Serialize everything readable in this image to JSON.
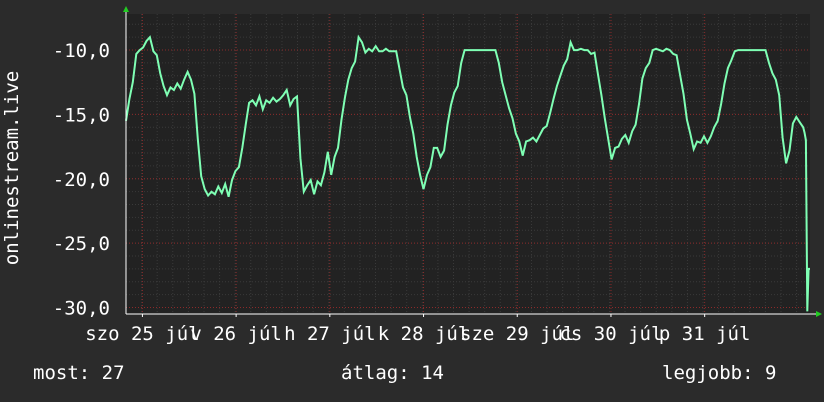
{
  "chart_data": {
    "type": "line",
    "ylabel": "onlinestream.live",
    "ylim": [
      -30.5,
      -7.2
    ],
    "yticks": [
      -30,
      -25,
      -20,
      -15,
      -10
    ],
    "ytick_labels": [
      "-30,0",
      "-25,0",
      "-20,0",
      "-15,0",
      "-10,0"
    ],
    "xlim": [
      0,
      100
    ],
    "xticks": [
      {
        "pos": 2.4,
        "label": "szo 25 júl"
      },
      {
        "pos": 16.1,
        "label": "v 26 júl"
      },
      {
        "pos": 29.8,
        "label": "h 27 júl"
      },
      {
        "pos": 43.5,
        "label": "k 28 júl"
      },
      {
        "pos": 57.2,
        "label": "sze 29 júl"
      },
      {
        "pos": 70.9,
        "label": "cs 30 júl"
      },
      {
        "pos": 84.6,
        "label": "p 31 júl"
      }
    ],
    "series": [
      {
        "color": "#7fffb4",
        "x": [
          0,
          0.5,
          1,
          1.5,
          2,
          2.5,
          3,
          3.5,
          4,
          4.5,
          5,
          5.5,
          6,
          6.5,
          7,
          7.5,
          8,
          8.5,
          9,
          9.5,
          10,
          10.5,
          11,
          11.5,
          12,
          12.5,
          13,
          13.5,
          14,
          14.5,
          15,
          15.5,
          16,
          16.5,
          17,
          17.5,
          18,
          18.5,
          19,
          19.5,
          20,
          20.5,
          21,
          21.5,
          22,
          22.5,
          23,
          23.5,
          24,
          24.5,
          25,
          25.5,
          26,
          26.5,
          27,
          27.5,
          28,
          28.5,
          29,
          29.5,
          30,
          30.5,
          31,
          31.5,
          32,
          32.5,
          33,
          33.5,
          34,
          34.5,
          35,
          35.5,
          36,
          36.5,
          37,
          37.5,
          38,
          38.5,
          39,
          39.5,
          40,
          40.5,
          41,
          41.5,
          42,
          42.5,
          43,
          43.5,
          44,
          44.5,
          45,
          45.5,
          46,
          46.5,
          47,
          47.5,
          48,
          48.5,
          49,
          49.5,
          50,
          50.5,
          51,
          51.5,
          52,
          52.5,
          53,
          53.5,
          54,
          54.5,
          55,
          55.5,
          56,
          56.5,
          57,
          57.5,
          58,
          58.5,
          59,
          59.5,
          60,
          60.5,
          61,
          61.5,
          62,
          62.5,
          63,
          63.5,
          64,
          64.5,
          65,
          65.5,
          66,
          66.5,
          67,
          67.5,
          68,
          68.5,
          69,
          69.5,
          70,
          70.5,
          71,
          71.5,
          72,
          72.5,
          73,
          73.5,
          74,
          74.5,
          75,
          75.5,
          76,
          76.5,
          77,
          77.5,
          78,
          78.5,
          79,
          79.5,
          80,
          80.5,
          81,
          81.5,
          82,
          82.5,
          83,
          83.5,
          84,
          84.5,
          85,
          85.5,
          86,
          86.5,
          87,
          87.5,
          88,
          88.5,
          89,
          89.5,
          90,
          90.5,
          91,
          91.5,
          92,
          92.5,
          93,
          93.5,
          94,
          94.5,
          95,
          95.5,
          96,
          96.5,
          97,
          97.5,
          98,
          98.5,
          99,
          99.2,
          99.4,
          99.6,
          99.8,
          100
        ],
        "values": [
          -15.5,
          -13.8,
          -12.5,
          -10.3,
          -10.0,
          -9.8,
          -9.3,
          -9.0,
          -10.1,
          -10.4,
          -11.8,
          -12.8,
          -13.5,
          -12.9,
          -13.1,
          -12.6,
          -13.0,
          -12.3,
          -11.7,
          -12.3,
          -13.4,
          -16.9,
          -19.8,
          -20.8,
          -21.3,
          -21.0,
          -21.2,
          -20.6,
          -21.1,
          -20.4,
          -21.4,
          -20.1,
          -19.4,
          -19.1,
          -17.6,
          -15.8,
          -14.1,
          -13.9,
          -14.3,
          -13.6,
          -14.6,
          -13.9,
          -14.1,
          -13.7,
          -14.0,
          -13.8,
          -13.5,
          -13.1,
          -14.3,
          -13.8,
          -13.6,
          -18.4,
          -21.0,
          -20.5,
          -20.1,
          -21.2,
          -20.2,
          -20.5,
          -19.5,
          -17.9,
          -19.7,
          -18.3,
          -17.6,
          -15.4,
          -13.7,
          -12.3,
          -11.4,
          -10.9,
          -9.0,
          -9.4,
          -10.2,
          -9.9,
          -10.1,
          -9.7,
          -10.1,
          -10.1,
          -9.9,
          -10.1,
          -10.1,
          -10.1,
          -11.5,
          -12.9,
          -13.5,
          -15.2,
          -16.5,
          -18.3,
          -19.7,
          -20.8,
          -19.7,
          -19.1,
          -17.6,
          -17.6,
          -18.3,
          -17.8,
          -15.8,
          -14.3,
          -13.3,
          -12.8,
          -11.0,
          -10.0,
          -10.0,
          -10.0,
          -10.0,
          -10.0,
          -10.0,
          -10.0,
          -10.0,
          -10.0,
          -10.0,
          -11.0,
          -12.5,
          -13.5,
          -14.5,
          -15.3,
          -16.5,
          -17.1,
          -18.2,
          -17.1,
          -17.0,
          -16.8,
          -17.1,
          -16.6,
          -16.1,
          -15.9,
          -14.9,
          -13.8,
          -12.8,
          -12.0,
          -11.2,
          -10.7,
          -9.4,
          -10.0,
          -10.0,
          -9.9,
          -10.0,
          -10.0,
          -10.3,
          -10.2,
          -11.9,
          -13.5,
          -15.3,
          -16.9,
          -18.5,
          -17.6,
          -17.5,
          -16.9,
          -16.6,
          -17.2,
          -16.3,
          -15.8,
          -14.2,
          -12.2,
          -11.4,
          -11.0,
          -10.0,
          -9.9,
          -10.0,
          -10.1,
          -9.9,
          -10.0,
          -10.3,
          -10.4,
          -11.9,
          -13.4,
          -15.4,
          -16.5,
          -17.7,
          -17.1,
          -17.2,
          -16.7,
          -17.2,
          -16.7,
          -16.0,
          -15.5,
          -14.2,
          -12.6,
          -11.4,
          -10.8,
          -10.1,
          -10.0,
          -10.0,
          -10.0,
          -10.0,
          -10.0,
          -10.0,
          -10.0,
          -10.0,
          -10.0,
          -11.0,
          -11.8,
          -12.3,
          -13.5,
          -16.8,
          -18.8,
          -17.8,
          -15.7,
          -15.2,
          -15.6,
          -16.0,
          -16.4,
          -17.0,
          -30.3,
          -27.0,
          -27.0
        ]
      }
    ],
    "grid": true,
    "legend": "none"
  },
  "stats": {
    "now": "most: 27",
    "avg": "átlag: 14",
    "best": "legjobb: 9"
  },
  "colors": {
    "background": "#2b2b2b",
    "plot_background": "#222222",
    "grid_minor": "#3a3a3a",
    "grid_major": "#8b2a2a",
    "axis_arrow": "#22cc22",
    "line": "#7fffb4",
    "text": "#ffffff"
  }
}
